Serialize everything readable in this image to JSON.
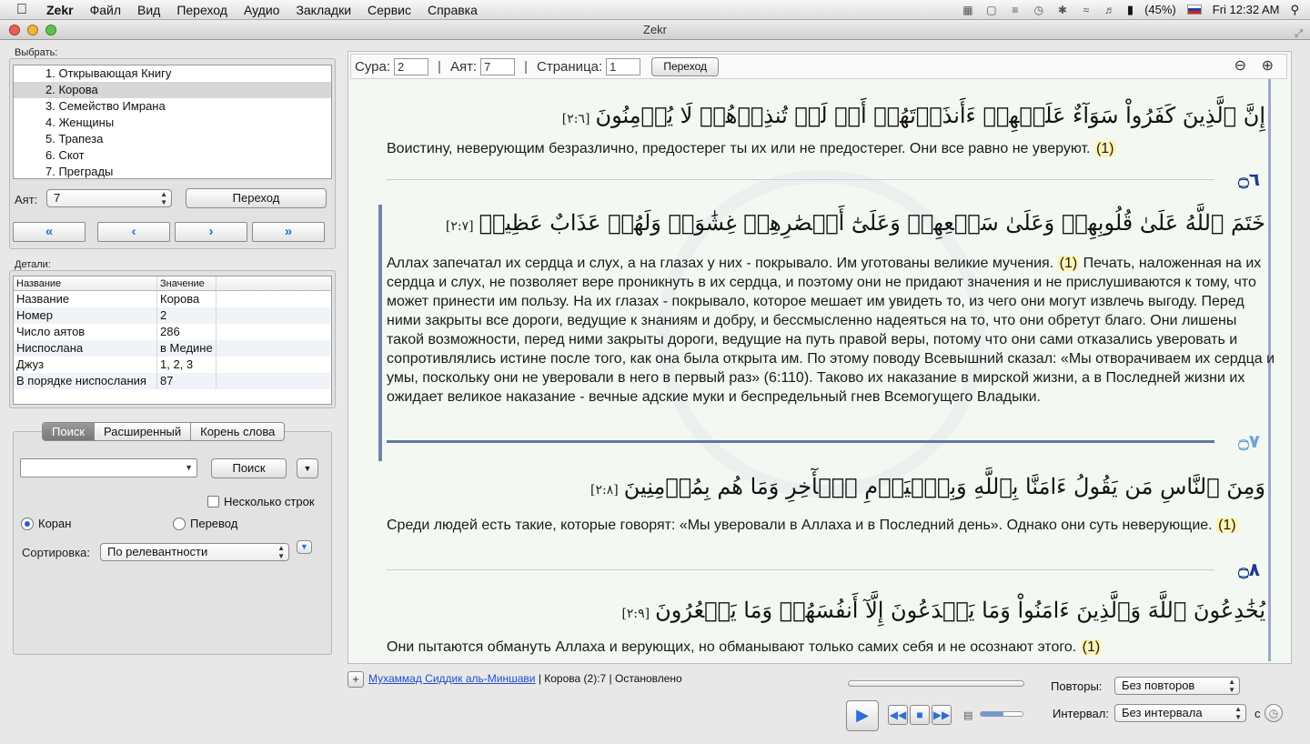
{
  "menubar": {
    "app": "Zekr",
    "items": [
      "Файл",
      "Вид",
      "Переход",
      "Аудио",
      "Закладки",
      "Сервис",
      "Справка"
    ],
    "battery": "(45%)",
    "clock": "Fri 12:32 AM"
  },
  "window": {
    "title": "Zekr"
  },
  "sidebar": {
    "choose_label": "Выбрать:",
    "suras": [
      "1. Открывающая Книгу",
      "2. Корова",
      "3. Семейство Имрана",
      "4. Женщины",
      "5. Трапеза",
      "6. Скот",
      "7. Преграды"
    ],
    "selected_index": 1,
    "ayah_label": "Аят:",
    "ayah_value": "7",
    "go_label": "Переход",
    "nav": [
      "«",
      "‹",
      "›",
      "»"
    ]
  },
  "details": {
    "label": "Детали:",
    "headers": [
      "Название",
      "Значение"
    ],
    "rows": [
      [
        "Название",
        "Корова"
      ],
      [
        "Номер",
        "2"
      ],
      [
        "Число аятов",
        "286"
      ],
      [
        "Ниспослана",
        "в Медине"
      ],
      [
        "Джуз",
        "1, 2, 3"
      ],
      [
        "В порядке ниспослания",
        "87"
      ]
    ]
  },
  "search": {
    "tabs": [
      "Поиск",
      "Расширенный",
      "Корень слова"
    ],
    "search_button": "Поиск",
    "multi_line": "Несколько строк",
    "radio_quran": "Коран",
    "radio_translation": "Перевод",
    "sort_label": "Сортировка:",
    "sort_value": "По релевантности"
  },
  "toolbar": {
    "sura_label": "Сура:",
    "sura_value": "2",
    "ayah_label": "Аят:",
    "ayah_value": "7",
    "page_label": "Страница:",
    "page_value": "1",
    "go_label": "Переход"
  },
  "verses": [
    {
      "arabic": "إِنَّ ٱلَّذِينَ كَفَرُواْ سَوَآءٌ عَلَيۡهِمۡ ءَأَنذَرۡتَهُمۡ أَمۡ لَمۡ تُنذِرۡهُمۡ لَا يُؤۡمِنُونَ",
      "ref": "[٢:٦]",
      "translation": "Воистину, неверующим безразлично, предостерег ты их или не предостерег. Они все равно не уверуют.",
      "note": "(1)",
      "marker": "۝٦"
    },
    {
      "arabic": "خَتَمَ ٱللَّهُ عَلَىٰ قُلُوبِهِمۡ وَعَلَىٰ سَمۡعِهِمۡ وَعَلَىٰٓ أَبۡصَٰرِهِمۡ غِشَٰوَةٞ وَلَهُمۡ عَذَابٌ عَظِيمٞ",
      "ref": "[٢:٧]",
      "translation": "Аллах запечатал их сердца и слух, а на глазах у них - покрывало. Им уготованы великие мучения.",
      "note": "(1)",
      "commentary": "Печать, наложенная на их сердца и слух, не позволяет вере проникнуть в их сердца, и поэтому они не придают значения и не прислушиваются к тому, что может принести им пользу. На их глазах - покрывало, которое мешает им увидеть то, из чего они могут извлечь выгоду. Перед ними закрыты все дороги, ведущие к знаниям и добру, и бессмысленно надеяться на то, что они обретут благо. Они лишены такой возможности, перед ними закрыты дороги, ведущие на путь правой веры, потому что они сами отказались уверовать и сопротивлялись истине после того, как она была открыта им. По этому поводу Всевышний сказал: «Мы отворачиваем их сердца и умы, поскольку они не уверовали в него в первый раз» (6:110). Таково их наказание в мирской жизни, а в Последней жизни их ожидает великое наказание - вечные адские муки и беспредельный гнев Всемогущего Владыки.",
      "marker": "۝٧"
    },
    {
      "arabic": "وَمِنَ ٱلنَّاسِ مَن يَقُولُ ءَامَنَّا بِٱللَّهِ وَبِٱلۡيَوۡمِ ٱلۡأٓخِرِ وَمَا هُم بِمُؤۡمِنِينَ",
      "ref": "[٢:٨]",
      "translation": "Среди людей есть такие, которые говорят: «Мы уверовали в Аллаха и в Последний день». Однако они суть неверующие.",
      "note": "(1)",
      "marker": "۝٨"
    },
    {
      "arabic": "يُخَٰدِعُونَ ٱللَّهَ وَٱلَّذِينَ ءَامَنُواْ وَمَا يَخۡدَعُونَ إِلَّآ أَنفُسَهُمۡ وَمَا يَشۡعُرُونَ",
      "ref": "[٢:٩]",
      "translation": "Они пытаются обмануть Аллаха и верующих, но обманывают только самих себя и не осознают этого.",
      "note": "(1)"
    }
  ],
  "player": {
    "reciter": "Мухаммад Сиддик аль-Миншави",
    "status": "| Корова (2):7 | Остановлено",
    "repeat_label": "Повторы:",
    "repeat_value": "Без повторов",
    "interval_label": "Интервал:",
    "interval_value": "Без интервала",
    "interval_unit": "с",
    "volume": 0.55
  }
}
